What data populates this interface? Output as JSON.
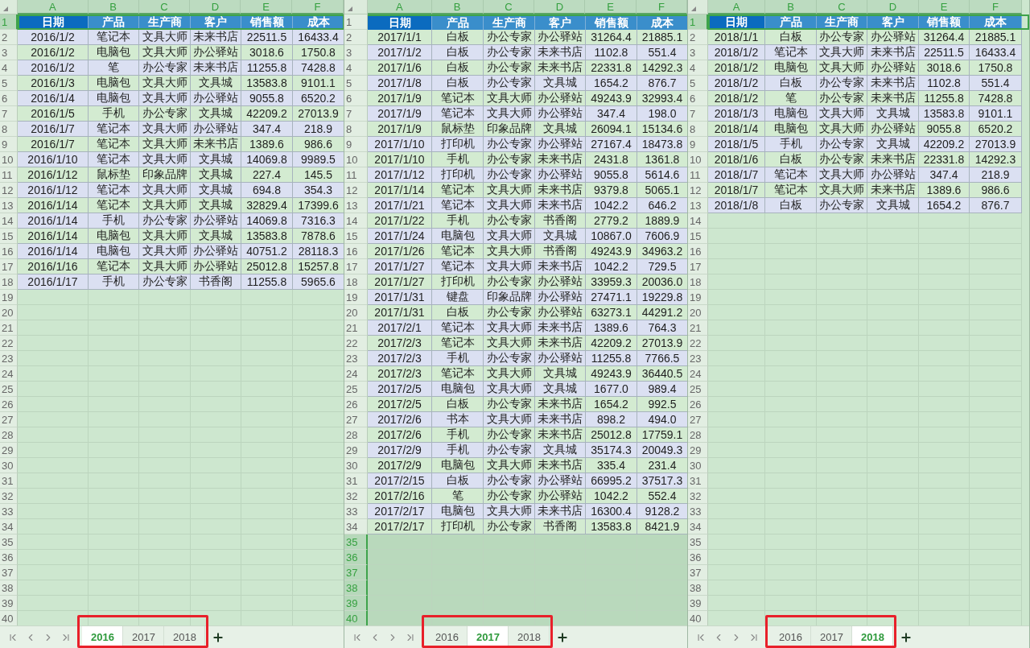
{
  "panes": [
    {
      "column_letters": [
        "A",
        "B",
        "C",
        "D",
        "E",
        "F"
      ],
      "header": {
        "number": "1",
        "selected": true,
        "cells": [
          {
            "text": "日期",
            "selected": true
          },
          {
            "text": "产品",
            "selected": false
          },
          {
            "text": "生产商",
            "selected": false
          },
          {
            "text": "客户",
            "selected": false
          },
          {
            "text": "销售额",
            "selected": false
          },
          {
            "text": "成本",
            "selected": false
          }
        ]
      },
      "rows": [
        {
          "number": "2",
          "color": "#dbe0f2",
          "cells": [
            "2016/1/2",
            "笔记本",
            "文具大师",
            "未来书店",
            "22511.5",
            "16433.4"
          ]
        },
        {
          "number": "3",
          "color": "#d3ebd1",
          "cells": [
            "2016/1/2",
            "电脑包",
            "文具大师",
            "办公驿站",
            "3018.6",
            "1750.8"
          ]
        },
        {
          "number": "4",
          "color": "#dbe0f2",
          "cells": [
            "2016/1/2",
            "笔",
            "办公专家",
            "未来书店",
            "11255.8",
            "7428.8"
          ]
        },
        {
          "number": "5",
          "color": "#d3ebd1",
          "cells": [
            "2016/1/3",
            "电脑包",
            "文具大师",
            "文具城",
            "13583.8",
            "9101.1"
          ]
        },
        {
          "number": "6",
          "color": "#dbe0f2",
          "cells": [
            "2016/1/4",
            "电脑包",
            "文具大师",
            "办公驿站",
            "9055.8",
            "6520.2"
          ]
        },
        {
          "number": "7",
          "color": "#d3ebd1",
          "cells": [
            "2016/1/5",
            "手机",
            "办公专家",
            "文具城",
            "42209.2",
            "27013.9"
          ]
        },
        {
          "number": "8",
          "color": "#dbe0f2",
          "cells": [
            "2016/1/7",
            "笔记本",
            "文具大师",
            "办公驿站",
            "347.4",
            "218.9"
          ]
        },
        {
          "number": "9",
          "color": "#d3ebd1",
          "cells": [
            "2016/1/7",
            "笔记本",
            "文具大师",
            "未来书店",
            "1389.6",
            "986.6"
          ]
        },
        {
          "number": "10",
          "color": "#dbe0f2",
          "cells": [
            "2016/1/10",
            "笔记本",
            "文具大师",
            "文具城",
            "14069.8",
            "9989.5"
          ]
        },
        {
          "number": "11",
          "color": "#d3ebd1",
          "cells": [
            "2016/1/12",
            "鼠标垫",
            "印象品牌",
            "文具城",
            "227.4",
            "145.5"
          ]
        },
        {
          "number": "12",
          "color": "#dbe0f2",
          "cells": [
            "2016/1/12",
            "笔记本",
            "文具大师",
            "文具城",
            "694.8",
            "354.3"
          ]
        },
        {
          "number": "13",
          "color": "#d3ebd1",
          "cells": [
            "2016/1/14",
            "笔记本",
            "文具大师",
            "文具城",
            "32829.4",
            "17399.6"
          ]
        },
        {
          "number": "14",
          "color": "#dbe0f2",
          "cells": [
            "2016/1/14",
            "手机",
            "办公专家",
            "办公驿站",
            "14069.8",
            "7316.3"
          ]
        },
        {
          "number": "15",
          "color": "#d3ebd1",
          "cells": [
            "2016/1/14",
            "电脑包",
            "文具大师",
            "文具城",
            "13583.8",
            "7878.6"
          ]
        },
        {
          "number": "16",
          "color": "#dbe0f2",
          "cells": [
            "2016/1/14",
            "电脑包",
            "文具大师",
            "办公驿站",
            "40751.2",
            "28118.3"
          ]
        },
        {
          "number": "17",
          "color": "#d3ebd1",
          "cells": [
            "2016/1/16",
            "笔记本",
            "文具大师",
            "办公驿站",
            "25012.8",
            "15257.8"
          ]
        },
        {
          "number": "18",
          "color": "#dbe0f2",
          "cells": [
            "2016/1/17",
            "手机",
            "办公专家",
            "书香阁",
            "11255.8",
            "5965.6"
          ]
        }
      ],
      "empty_rows": [
        {
          "number": "19",
          "selected": false
        },
        {
          "number": "20",
          "selected": false
        },
        {
          "number": "21",
          "selected": false
        },
        {
          "number": "22",
          "selected": false
        },
        {
          "number": "23",
          "selected": false
        },
        {
          "number": "24",
          "selected": false
        },
        {
          "number": "25",
          "selected": false
        },
        {
          "number": "26",
          "selected": false
        },
        {
          "number": "27",
          "selected": false
        },
        {
          "number": "28",
          "selected": false
        },
        {
          "number": "29",
          "selected": false
        },
        {
          "number": "30",
          "selected": false
        },
        {
          "number": "31",
          "selected": false
        },
        {
          "number": "32",
          "selected": false
        },
        {
          "number": "33",
          "selected": false
        },
        {
          "number": "34",
          "selected": false
        },
        {
          "number": "35",
          "selected": false
        },
        {
          "number": "36",
          "selected": false
        },
        {
          "number": "37",
          "selected": false
        },
        {
          "number": "38",
          "selected": false
        },
        {
          "number": "39",
          "selected": false
        },
        {
          "number": "40",
          "selected": false
        }
      ],
      "tabs": [
        {
          "label": "2016",
          "selected": true
        },
        {
          "label": "2017",
          "selected": false
        },
        {
          "label": "2018",
          "selected": false
        }
      ],
      "tabs_highlighted": true
    },
    {
      "column_letters": [
        "A",
        "B",
        "C",
        "D",
        "E",
        "F"
      ],
      "header": {
        "number": "1",
        "selected": false,
        "cells": [
          {
            "text": "日期",
            "selected": true
          },
          {
            "text": "产品",
            "selected": false
          },
          {
            "text": "生产商",
            "selected": false
          },
          {
            "text": "客户",
            "selected": false
          },
          {
            "text": "销售额",
            "selected": false
          },
          {
            "text": "成本",
            "selected": false
          }
        ]
      },
      "rows": [
        {
          "number": "2",
          "color": "#d3ebd1",
          "cells": [
            "2017/1/1",
            "白板",
            "办公专家",
            "办公驿站",
            "31264.4",
            "21885.1"
          ]
        },
        {
          "number": "3",
          "color": "#dbe0f2",
          "cells": [
            "2017/1/2",
            "白板",
            "办公专家",
            "未来书店",
            "1102.8",
            "551.4"
          ]
        },
        {
          "number": "4",
          "color": "#d3ebd1",
          "cells": [
            "2017/1/6",
            "白板",
            "办公专家",
            "未来书店",
            "22331.8",
            "14292.3"
          ]
        },
        {
          "number": "5",
          "color": "#dbe0f2",
          "cells": [
            "2017/1/8",
            "白板",
            "办公专家",
            "文具城",
            "1654.2",
            "876.7"
          ]
        },
        {
          "number": "6",
          "color": "#d3ebd1",
          "cells": [
            "2017/1/9",
            "笔记本",
            "文具大师",
            "办公驿站",
            "49243.9",
            "32993.4"
          ]
        },
        {
          "number": "7",
          "color": "#dbe0f2",
          "cells": [
            "2017/1/9",
            "笔记本",
            "文具大师",
            "办公驿站",
            "347.4",
            "198.0"
          ]
        },
        {
          "number": "8",
          "color": "#d3ebd1",
          "cells": [
            "2017/1/9",
            "鼠标垫",
            "印象品牌",
            "文具城",
            "26094.1",
            "15134.6"
          ]
        },
        {
          "number": "9",
          "color": "#dbe0f2",
          "cells": [
            "2017/1/10",
            "打印机",
            "办公专家",
            "办公驿站",
            "27167.4",
            "18473.8"
          ]
        },
        {
          "number": "10",
          "color": "#d3ebd1",
          "cells": [
            "2017/1/10",
            "手机",
            "办公专家",
            "未来书店",
            "2431.8",
            "1361.8"
          ]
        },
        {
          "number": "11",
          "color": "#dbe0f2",
          "cells": [
            "2017/1/12",
            "打印机",
            "办公专家",
            "办公驿站",
            "9055.8",
            "5614.6"
          ]
        },
        {
          "number": "12",
          "color": "#d3ebd1",
          "cells": [
            "2017/1/14",
            "笔记本",
            "文具大师",
            "未来书店",
            "9379.8",
            "5065.1"
          ]
        },
        {
          "number": "13",
          "color": "#dbe0f2",
          "cells": [
            "2017/1/21",
            "笔记本",
            "文具大师",
            "未来书店",
            "1042.2",
            "646.2"
          ]
        },
        {
          "number": "14",
          "color": "#d3ebd1",
          "cells": [
            "2017/1/22",
            "手机",
            "办公专家",
            "书香阁",
            "2779.2",
            "1889.9"
          ]
        },
        {
          "number": "15",
          "color": "#dbe0f2",
          "cells": [
            "2017/1/24",
            "电脑包",
            "文具大师",
            "文具城",
            "10867.0",
            "7606.9"
          ]
        },
        {
          "number": "16",
          "color": "#d3ebd1",
          "cells": [
            "2017/1/26",
            "笔记本",
            "文具大师",
            "书香阁",
            "49243.9",
            "34963.2"
          ]
        },
        {
          "number": "17",
          "color": "#dbe0f2",
          "cells": [
            "2017/1/27",
            "笔记本",
            "文具大师",
            "未来书店",
            "1042.2",
            "729.5"
          ]
        },
        {
          "number": "18",
          "color": "#d3ebd1",
          "cells": [
            "2017/1/27",
            "打印机",
            "办公专家",
            "办公驿站",
            "33959.3",
            "20036.0"
          ]
        },
        {
          "number": "19",
          "color": "#dbe0f2",
          "cells": [
            "2017/1/31",
            "键盘",
            "印象品牌",
            "办公驿站",
            "27471.1",
            "19229.8"
          ]
        },
        {
          "number": "20",
          "color": "#d3ebd1",
          "cells": [
            "2017/1/31",
            "白板",
            "办公专家",
            "办公驿站",
            "63273.1",
            "44291.2"
          ]
        },
        {
          "number": "21",
          "color": "#dbe0f2",
          "cells": [
            "2017/2/1",
            "笔记本",
            "文具大师",
            "未来书店",
            "1389.6",
            "764.3"
          ]
        },
        {
          "number": "22",
          "color": "#d3ebd1",
          "cells": [
            "2017/2/3",
            "笔记本",
            "文具大师",
            "未来书店",
            "42209.2",
            "27013.9"
          ]
        },
        {
          "number": "23",
          "color": "#dbe0f2",
          "cells": [
            "2017/2/3",
            "手机",
            "办公专家",
            "办公驿站",
            "11255.8",
            "7766.5"
          ]
        },
        {
          "number": "24",
          "color": "#d3ebd1",
          "cells": [
            "2017/2/3",
            "笔记本",
            "文具大师",
            "文具城",
            "49243.9",
            "36440.5"
          ]
        },
        {
          "number": "25",
          "color": "#dbe0f2",
          "cells": [
            "2017/2/5",
            "电脑包",
            "文具大师",
            "文具城",
            "1677.0",
            "989.4"
          ]
        },
        {
          "number": "26",
          "color": "#d3ebd1",
          "cells": [
            "2017/2/5",
            "白板",
            "办公专家",
            "未来书店",
            "1654.2",
            "992.5"
          ]
        },
        {
          "number": "27",
          "color": "#dbe0f2",
          "cells": [
            "2017/2/6",
            "书本",
            "文具大师",
            "未来书店",
            "898.2",
            "494.0"
          ]
        },
        {
          "number": "28",
          "color": "#d3ebd1",
          "cells": [
            "2017/2/6",
            "手机",
            "办公专家",
            "未来书店",
            "25012.8",
            "17759.1"
          ]
        },
        {
          "number": "29",
          "color": "#dbe0f2",
          "cells": [
            "2017/2/9",
            "手机",
            "办公专家",
            "文具城",
            "35174.3",
            "20049.3"
          ]
        },
        {
          "number": "30",
          "color": "#d3ebd1",
          "cells": [
            "2017/2/9",
            "电脑包",
            "文具大师",
            "未来书店",
            "335.4",
            "231.4"
          ]
        },
        {
          "number": "31",
          "color": "#dbe0f2",
          "cells": [
            "2017/2/15",
            "白板",
            "办公专家",
            "办公驿站",
            "66995.2",
            "37517.3"
          ]
        },
        {
          "number": "32",
          "color": "#d3ebd1",
          "cells": [
            "2017/2/16",
            "笔",
            "办公专家",
            "办公驿站",
            "1042.2",
            "552.4"
          ]
        },
        {
          "number": "33",
          "color": "#dbe0f2",
          "cells": [
            "2017/2/17",
            "电脑包",
            "文具大师",
            "未来书店",
            "16300.4",
            "9128.2"
          ]
        },
        {
          "number": "34",
          "color": "#d3ebd1",
          "cells": [
            "2017/2/17",
            "打印机",
            "办公专家",
            "书香阁",
            "13583.8",
            "8421.9"
          ]
        }
      ],
      "empty_rows": [
        {
          "number": "35",
          "selected": true
        },
        {
          "number": "36",
          "selected": true
        },
        {
          "number": "37",
          "selected": true
        },
        {
          "number": "38",
          "selected": true
        },
        {
          "number": "39",
          "selected": true
        },
        {
          "number": "40",
          "selected": true
        }
      ],
      "tabs": [
        {
          "label": "2016",
          "selected": false
        },
        {
          "label": "2017",
          "selected": true
        },
        {
          "label": "2018",
          "selected": false
        }
      ],
      "tabs_highlighted": true
    },
    {
      "column_letters": [
        "A",
        "B",
        "C",
        "D",
        "E",
        "F"
      ],
      "header": {
        "number": "1",
        "selected": true,
        "cells": [
          {
            "text": "日期",
            "selected": true
          },
          {
            "text": "产品",
            "selected": false
          },
          {
            "text": "生产商",
            "selected": false
          },
          {
            "text": "客户",
            "selected": false
          },
          {
            "text": "销售额",
            "selected": false
          },
          {
            "text": "成本",
            "selected": false
          }
        ]
      },
      "rows": [
        {
          "number": "2",
          "color": "#d3ebd1",
          "cells": [
            "2018/1/1",
            "白板",
            "办公专家",
            "办公驿站",
            "31264.4",
            "21885.1"
          ]
        },
        {
          "number": "3",
          "color": "#dbe0f2",
          "cells": [
            "2018/1/2",
            "笔记本",
            "文具大师",
            "未来书店",
            "22511.5",
            "16433.4"
          ]
        },
        {
          "number": "4",
          "color": "#d3ebd1",
          "cells": [
            "2018/1/2",
            "电脑包",
            "文具大师",
            "办公驿站",
            "3018.6",
            "1750.8"
          ]
        },
        {
          "number": "5",
          "color": "#dbe0f2",
          "cells": [
            "2018/1/2",
            "白板",
            "办公专家",
            "未来书店",
            "1102.8",
            "551.4"
          ]
        },
        {
          "number": "6",
          "color": "#d3ebd1",
          "cells": [
            "2018/1/2",
            "笔",
            "办公专家",
            "未来书店",
            "11255.8",
            "7428.8"
          ]
        },
        {
          "number": "7",
          "color": "#dbe0f2",
          "cells": [
            "2018/1/3",
            "电脑包",
            "文具大师",
            "文具城",
            "13583.8",
            "9101.1"
          ]
        },
        {
          "number": "8",
          "color": "#d3ebd1",
          "cells": [
            "2018/1/4",
            "电脑包",
            "文具大师",
            "办公驿站",
            "9055.8",
            "6520.2"
          ]
        },
        {
          "number": "9",
          "color": "#dbe0f2",
          "cells": [
            "2018/1/5",
            "手机",
            "办公专家",
            "文具城",
            "42209.2",
            "27013.9"
          ]
        },
        {
          "number": "10",
          "color": "#d3ebd1",
          "cells": [
            "2018/1/6",
            "白板",
            "办公专家",
            "未来书店",
            "22331.8",
            "14292.3"
          ]
        },
        {
          "number": "11",
          "color": "#dbe0f2",
          "cells": [
            "2018/1/7",
            "笔记本",
            "文具大师",
            "办公驿站",
            "347.4",
            "218.9"
          ]
        },
        {
          "number": "12",
          "color": "#d3ebd1",
          "cells": [
            "2018/1/7",
            "笔记本",
            "文具大师",
            "未来书店",
            "1389.6",
            "986.6"
          ]
        },
        {
          "number": "13",
          "color": "#dbe0f2",
          "cells": [
            "2018/1/8",
            "白板",
            "办公专家",
            "文具城",
            "1654.2",
            "876.7"
          ]
        }
      ],
      "empty_rows": [
        {
          "number": "14",
          "selected": false
        },
        {
          "number": "15",
          "selected": false
        },
        {
          "number": "16",
          "selected": false
        },
        {
          "number": "17",
          "selected": false
        },
        {
          "number": "18",
          "selected": false
        },
        {
          "number": "19",
          "selected": false
        },
        {
          "number": "20",
          "selected": false
        },
        {
          "number": "21",
          "selected": false
        },
        {
          "number": "22",
          "selected": false
        },
        {
          "number": "23",
          "selected": false
        },
        {
          "number": "24",
          "selected": false
        },
        {
          "number": "25",
          "selected": false
        },
        {
          "number": "26",
          "selected": false
        },
        {
          "number": "27",
          "selected": false
        },
        {
          "number": "28",
          "selected": false
        },
        {
          "number": "29",
          "selected": false
        },
        {
          "number": "30",
          "selected": false
        },
        {
          "number": "31",
          "selected": false
        },
        {
          "number": "32",
          "selected": false
        },
        {
          "number": "33",
          "selected": false
        },
        {
          "number": "34",
          "selected": false
        },
        {
          "number": "35",
          "selected": false
        },
        {
          "number": "36",
          "selected": false
        },
        {
          "number": "37",
          "selected": false
        },
        {
          "number": "38",
          "selected": false
        },
        {
          "number": "39",
          "selected": false
        },
        {
          "number": "40",
          "selected": false
        }
      ],
      "tabs": [
        {
          "label": "2016",
          "selected": false
        },
        {
          "label": "2017",
          "selected": false
        },
        {
          "label": "2018",
          "selected": true
        }
      ],
      "tabs_highlighted": true
    }
  ]
}
